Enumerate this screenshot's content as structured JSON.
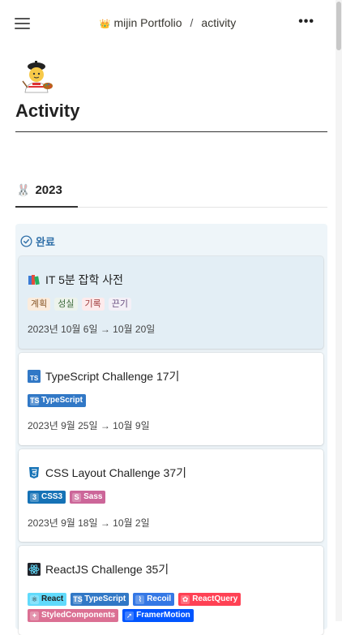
{
  "header": {
    "crown_icon": "crown-icon",
    "workspace": "mijin Portfolio",
    "separator": "/",
    "page": "activity",
    "more": "•••"
  },
  "page": {
    "icon": "artist-emoji",
    "title": "Activity"
  },
  "year_tab": {
    "icon": "rabbit-emoji",
    "label": "2023"
  },
  "board": {
    "status_label": "완료",
    "status_color": "#2f6fa8",
    "cards": [
      {
        "icon": "books-icon",
        "title": "IT 5분 잡학 사전",
        "tags": [
          {
            "label": "계획",
            "bg": "#fbecdd",
            "fg": "#8a5a2b"
          },
          {
            "label": "성실",
            "bg": "#edf3ec",
            "fg": "#3d6b3b"
          },
          {
            "label": "기록",
            "bg": "#fdebec",
            "fg": "#a13e3e"
          },
          {
            "label": "끈기",
            "bg": "#f4f0f7",
            "fg": "#6a4f80"
          }
        ],
        "dates": "2023년 10월 6일 → 10월 20일"
      },
      {
        "icon": "typescript-icon",
        "title": "TypeScript Challenge 17기",
        "chips": [
          {
            "label": "TypeScript",
            "glyph": "TS",
            "bg": "#3178c6"
          }
        ],
        "dates": "2023년 9월 25일 → 10월 9일"
      },
      {
        "icon": "css3-icon",
        "title": "CSS Layout Challenge 37기",
        "chips": [
          {
            "label": "CSS3",
            "glyph": "3",
            "bg": "#1572b6"
          },
          {
            "label": "Sass",
            "glyph": "S",
            "bg": "#cc6699"
          }
        ],
        "dates": "2023년 9월 18일 → 10월 2일"
      },
      {
        "icon": "react-icon",
        "title": "ReactJS Challenge 35기",
        "chips": [
          {
            "label": "React",
            "glyph": "⚛",
            "bg": "#61dafb",
            "fg": "#222"
          },
          {
            "label": "TypeScript",
            "glyph": "TS",
            "bg": "#3178c6"
          },
          {
            "label": "Recoil",
            "glyph": "⌇",
            "bg": "#3578e5"
          },
          {
            "label": "ReactQuery",
            "glyph": "✿",
            "bg": "#ff4154"
          },
          {
            "label": "StyledComponents",
            "glyph": "✦",
            "bg": "#db7093"
          },
          {
            "label": "FramerMotion",
            "glyph": "➚",
            "bg": "#0055ff"
          }
        ],
        "dates": ""
      }
    ]
  }
}
